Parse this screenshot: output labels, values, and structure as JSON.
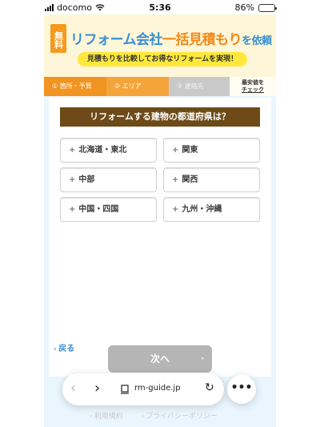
{
  "status_bar": {
    "carrier": "docomo",
    "time": "5:36",
    "battery": "86%",
    "battery_level": 0.86
  },
  "header": {
    "badge": "無料",
    "title_a": "リフォーム会社",
    "title_b": "一括見積もり",
    "title_c": "を依頼",
    "subtitle": "見積もりを比較してお得なリフォームを実現！"
  },
  "steps": [
    {
      "label": "① 箇所・予算"
    },
    {
      "label": "② エリア"
    },
    {
      "label": "③ 連絡先"
    },
    {
      "line1": "最安値を",
      "line2": "チェック"
    }
  ],
  "question": "リフォームする建物の都道府県は？",
  "options": [
    {
      "label": "北海道・東北"
    },
    {
      "label": "関東"
    },
    {
      "label": "中部"
    },
    {
      "label": "関西"
    },
    {
      "label": "中国・四国"
    },
    {
      "label": "九州・沖縄"
    }
  ],
  "plus_symbol": "+",
  "back_label": "戻る",
  "next_label": "次へ",
  "browser": {
    "url": "rm-guide.jp"
  },
  "footer": {
    "terms": "利用規約",
    "privacy": "プライバシーポリシー"
  },
  "colors": {
    "accent_orange": "#f29422",
    "brand_blue": "#3a8fd2",
    "question_brown": "#6d4a18",
    "disabled_gray": "#b5b5b5"
  },
  "icons": {
    "back": "chevron-left-icon",
    "forward": "chevron-right-icon",
    "reload": "reload-icon",
    "more": "more-icon",
    "page": "page-icon"
  }
}
